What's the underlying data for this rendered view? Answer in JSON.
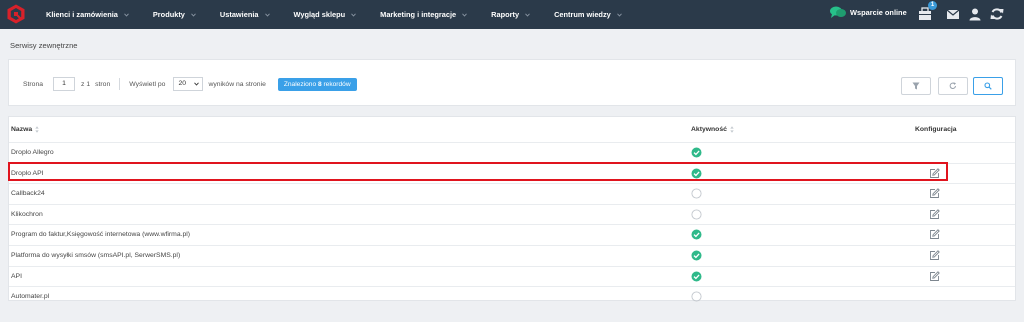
{
  "topbar": {
    "nav": [
      {
        "label": "Klienci i zamówienia"
      },
      {
        "label": "Produkty"
      },
      {
        "label": "Ustawienia"
      },
      {
        "label": "Wygląd sklepu"
      },
      {
        "label": "Marketing i integracje"
      },
      {
        "label": "Raporty"
      },
      {
        "label": "Centrum wiedzy"
      }
    ],
    "support_label": "Wsparcie online",
    "notification_count": "1",
    "icons": [
      "chat-icon",
      "package-icon",
      "mail-icon",
      "user-icon",
      "refresh-icon"
    ]
  },
  "page": {
    "title": "Serwisy zewnętrzne"
  },
  "pager": {
    "page_label": "Strona",
    "page_value": "1",
    "of_label": "z 1",
    "pages_label": "stron",
    "per_page_label": "Wyświetl po",
    "per_page_value": "20",
    "per_page_suffix": "wyników na stronie",
    "found_prefix": "Znaleziono",
    "found_count": "8",
    "found_suffix": "rekordów"
  },
  "table": {
    "headers": {
      "name": "Nazwa",
      "active": "Aktywność",
      "config": "Konfiguracja"
    },
    "rows": [
      {
        "name": "Droplo Allegro",
        "active": true,
        "configurable": false
      },
      {
        "name": "Droplo API",
        "active": true,
        "configurable": true,
        "highlighted": true
      },
      {
        "name": "Callback24",
        "active": false,
        "configurable": true
      },
      {
        "name": "Klikochron",
        "active": false,
        "configurable": true
      },
      {
        "name": "Program do faktur,Księgowość internetowa (www.wfirma.pl)",
        "active": true,
        "configurable": true
      },
      {
        "name": "Platforma do wysyłki smsów (smsAPI.pl, SerwerSMS.pl)",
        "active": true,
        "configurable": true
      },
      {
        "name": "API",
        "active": true,
        "configurable": true
      },
      {
        "name": "Automater.pl",
        "active": false,
        "configurable": false
      }
    ]
  },
  "colors": {
    "topbar": "#2b3a4a",
    "accent": "#3aa0e8",
    "active": "#2fb98a",
    "highlight": "#e0141e",
    "support": "#27c08a"
  }
}
